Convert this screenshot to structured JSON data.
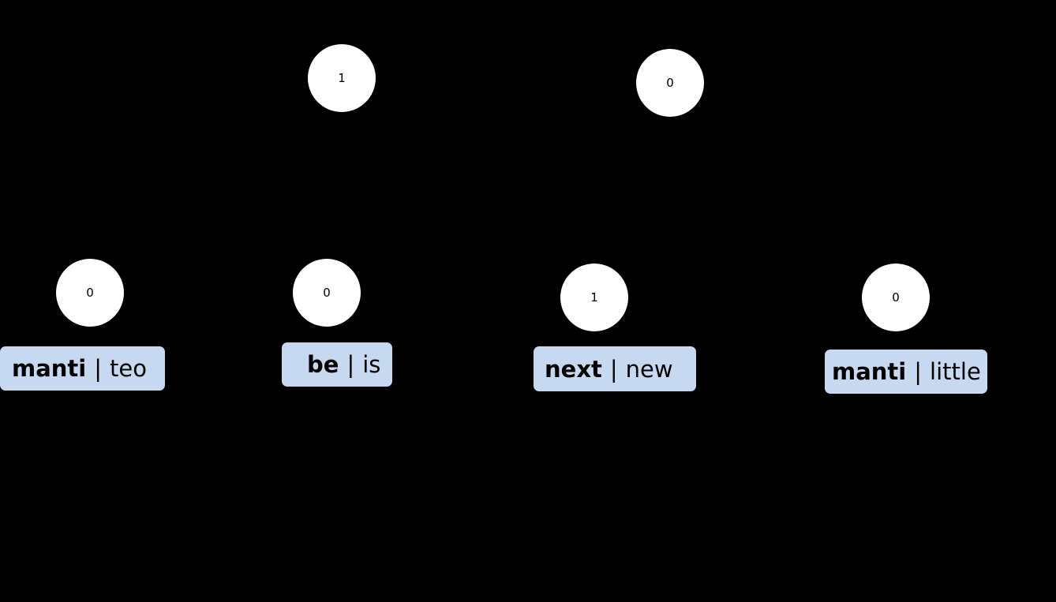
{
  "diagram": {
    "top_nodes": [
      {
        "value": "1"
      },
      {
        "value": "0"
      }
    ],
    "leaf_nodes": [
      {
        "value": "0",
        "label_bold": "manti",
        "separator": "|",
        "label_plain": "teo"
      },
      {
        "value": "0",
        "label_bold": "be",
        "separator": "|",
        "label_plain": "is"
      },
      {
        "value": "1",
        "label_bold": "next",
        "separator": "|",
        "label_plain": "new"
      },
      {
        "value": "0",
        "label_bold": "manti",
        "separator": "|",
        "label_plain": "little"
      }
    ],
    "colors": {
      "background": "#000000",
      "node_fill": "#ffffff",
      "label_fill": "#c6d9f0"
    }
  }
}
